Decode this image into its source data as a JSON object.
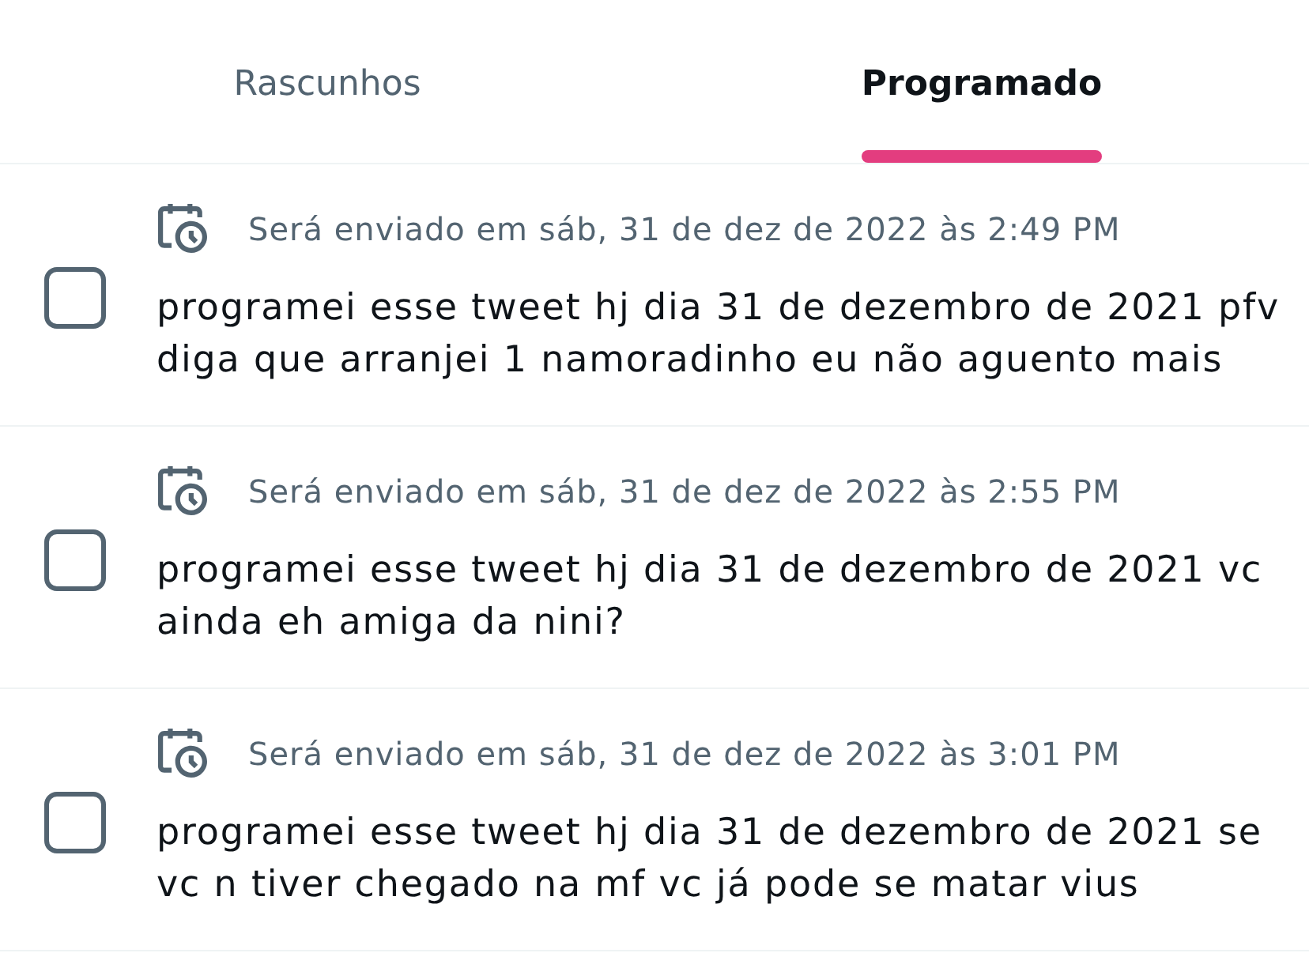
{
  "tabs": [
    {
      "label": "Rascunhos",
      "selected": false
    },
    {
      "label": "Programado",
      "selected": true
    }
  ],
  "scheduled_tweets": [
    {
      "checked": false,
      "schedule": "Será enviado em sáb, 31 de dez de 2022 às 2:49 PM",
      "text": "programei esse tweet hj dia 31 de dezembro de 2021 pfv diga que arranjei 1 namoradinho eu não aguento mais"
    },
    {
      "checked": false,
      "schedule": "Será enviado em sáb, 31 de dez de 2022 às 2:55 PM",
      "text": "programei esse tweet hj dia 31 de dezembro de 2021 vc ainda eh amiga da nini?"
    },
    {
      "checked": false,
      "schedule": "Será enviado em sáb, 31 de dez de 2022 às 3:01 PM",
      "text": "programei esse tweet hj dia 31 de dezembro de 2021 se vc n tiver chegado na mf vc já pode se matar vius"
    }
  ]
}
